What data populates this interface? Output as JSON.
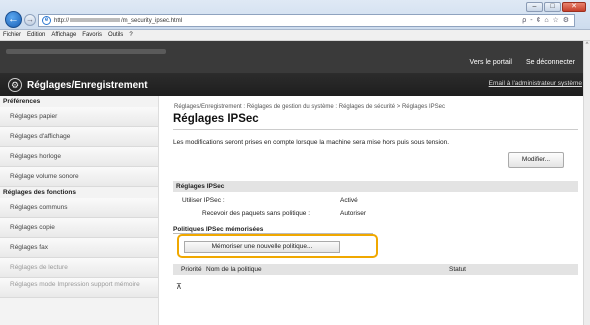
{
  "browser": {
    "url_prefix": "http://",
    "url_suffix": "/m_security_ipsec.html",
    "address_tools": "ρ - ¢  ⌂ ☆ ⚙",
    "window_buttons": {
      "minimize": "–",
      "maximize": "□",
      "close": "✕"
    },
    "back": "←",
    "forward": "→"
  },
  "menubar": [
    "Fichier",
    "Edition",
    "Affichage",
    "Favoris",
    "Outils",
    "?"
  ],
  "header": {
    "portal_link": "Vers le portail",
    "logout_link": "Se déconnecter",
    "title": "Réglages/Enregistrement",
    "admin_mail": "Email à l'administrateur système",
    "wrench_glyph": "⚙"
  },
  "sidebar": {
    "heading_preferences": "Préférences",
    "preferences": [
      "Réglages papier",
      "Réglages d'affichage",
      "Réglages horloge",
      "Réglage volume sonore"
    ],
    "heading_functions": "Réglages des fonctions",
    "functions": [
      "Réglages communs",
      "Réglages copie",
      "Réglages fax",
      "Réglages de lecture",
      "Réglages mode Impression support mémoire"
    ]
  },
  "main": {
    "breadcrumb": "Réglages/Enregistrement : Réglages de gestion du système : Réglages de sécurité > Réglages IPSec",
    "title": "Réglages IPSec",
    "notice": "Les modifications seront prises en compte lorsque la machine sera mise hors puis sous tension.",
    "edit_button": "Modifier...",
    "section": "Réglages IPSec",
    "use_label": "Utiliser IPSec :",
    "use_value": "Activé",
    "receive_label": "Recevoir des paquets sans politique :",
    "receive_value": "Autoriser",
    "registered": "Politiques IPSec mémorisées",
    "register_button": "Mémoriser une nouvelle politique...",
    "col_priority": "Priorité",
    "col_name": "Nom de la politique",
    "col_status": "Statut",
    "scroll_top": "⊼"
  }
}
